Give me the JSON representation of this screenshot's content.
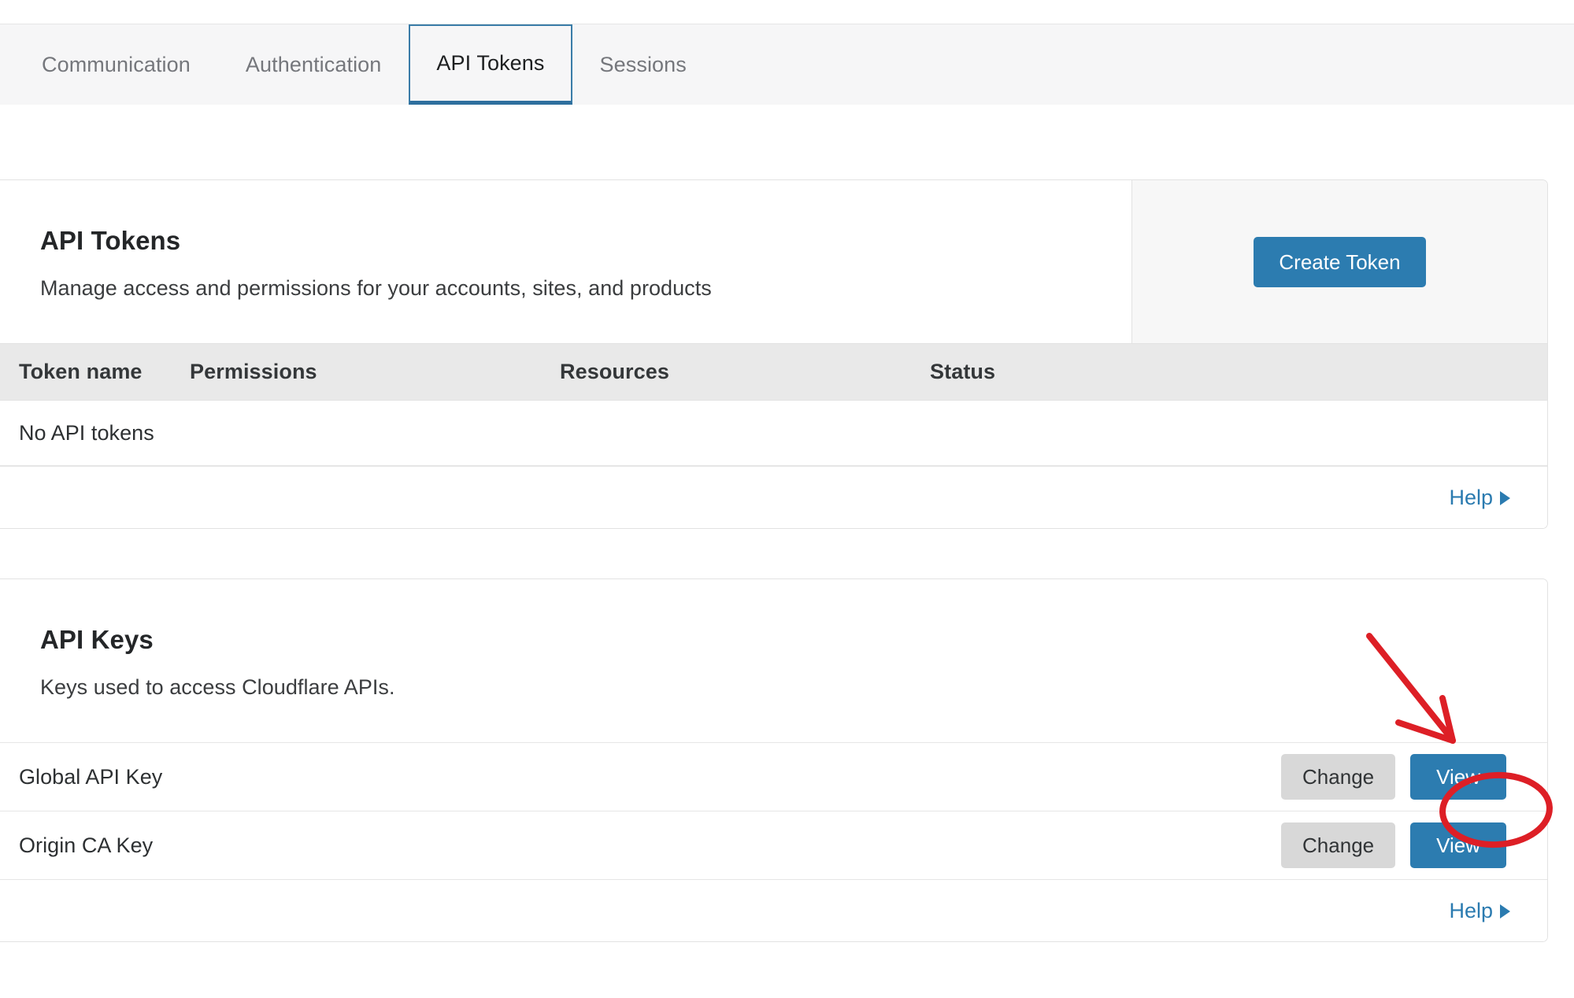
{
  "tabs": [
    {
      "label": "Communication",
      "active": false
    },
    {
      "label": "Authentication",
      "active": false
    },
    {
      "label": "API Tokens",
      "active": true
    },
    {
      "label": "Sessions",
      "active": false
    }
  ],
  "tokens_card": {
    "title": "API Tokens",
    "subtitle": "Manage access and permissions for your accounts, sites, and products",
    "create_button": "Create Token",
    "columns": [
      "Token name",
      "Permissions",
      "Resources",
      "Status"
    ],
    "empty_text": "No API tokens",
    "help_label": "Help"
  },
  "keys_card": {
    "title": "API Keys",
    "subtitle": "Keys used to access Cloudflare APIs.",
    "rows": [
      {
        "name": "Global API Key",
        "change_label": "Change",
        "view_label": "View",
        "highlighted": true
      },
      {
        "name": "Origin CA Key",
        "change_label": "Change",
        "view_label": "View",
        "highlighted": false
      }
    ],
    "help_label": "Help"
  },
  "annotation": {
    "color": "#dd1f26",
    "arrow_description": "red-hand-drawn-arrow-pointing-down-right-to-view-button",
    "ellipse_description": "red-hand-drawn-ellipse-around-global-api-key-view-button"
  },
  "colors": {
    "accent_blue": "#2c7cb0",
    "tab_active_border": "#3a7ca8",
    "link_blue": "#2b7bb0",
    "header_row_bg": "#e9e9e9",
    "secondary_button_bg": "#d8d8d8",
    "annotation_red": "#dd1f26"
  }
}
